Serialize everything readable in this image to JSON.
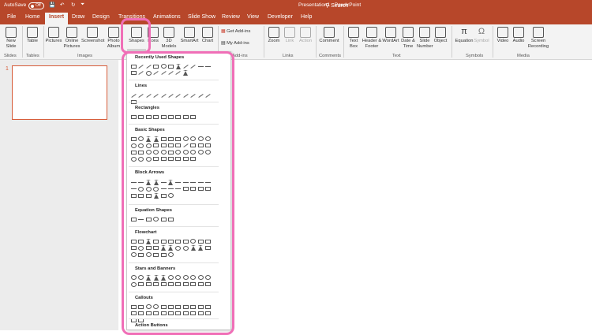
{
  "titlebar": {
    "autosave": "AutoSave",
    "toggle": "Off",
    "title": "Presentation1 - PowerPoint",
    "search": "Search"
  },
  "tabs": [
    "File",
    "Home",
    "Insert",
    "Draw",
    "Design",
    "Transitions",
    "Animations",
    "Slide Show",
    "Review",
    "View",
    "Developer",
    "Help"
  ],
  "ribbon": {
    "buttons": {
      "new_slide": "New Slide",
      "table": "Table",
      "pictures": "Pictures",
      "online_pictures": "Online Pictures",
      "screenshot": "Screenshot",
      "photo_album": "Photo Album",
      "shapes": "Shapes",
      "icons": "Icons",
      "models": "3D Models",
      "smartart": "SmartArt",
      "chart": "Chart",
      "get_addins": "Get Add-ins",
      "my_addins": "My Add-ins",
      "zoom": "Zoom",
      "link": "Link",
      "action": "Action",
      "comment": "Comment",
      "text_box": "Text Box",
      "header_footer": "Header & Footer",
      "wordart": "WordArt",
      "date_time": "Date & Time",
      "slide_number": "Slide Number",
      "object": "Object",
      "equation": "Equation",
      "symbol": "Symbol",
      "video": "Video",
      "audio": "Audio",
      "screen_recording": "Screen Recording"
    },
    "groups": {
      "slides": "Slides",
      "tables": "Tables",
      "images": "Images",
      "addins": "Add-ins",
      "links": "Links",
      "comments": "Comments",
      "text": "Text",
      "symbols": "Symbols",
      "media": "Media"
    }
  },
  "slides": {
    "number": "1"
  },
  "gallery": {
    "sections": [
      "Recently Used Shapes",
      "Lines",
      "Rectangles",
      "Basic Shapes",
      "Block Arrows",
      "Equation Shapes",
      "Flowchart",
      "Stars and Banners",
      "Callouts",
      "Action Buttons"
    ]
  },
  "colors": {
    "accent": "#b7472a",
    "highlight": "#f06fb7"
  }
}
